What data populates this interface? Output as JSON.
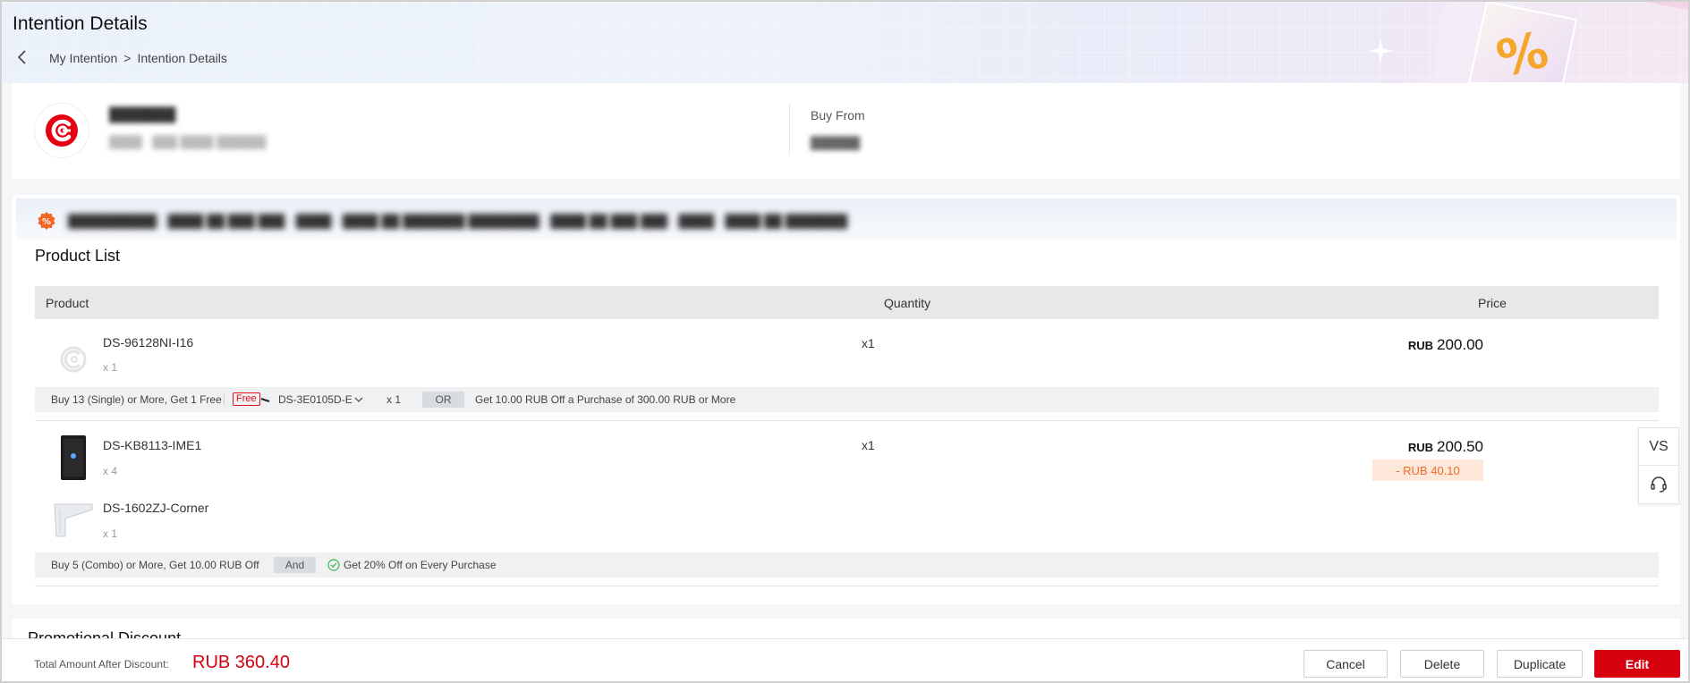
{
  "header": {
    "title": "Intention Details",
    "breadcrumb": [
      "My Intention",
      "Intention Details"
    ],
    "breadcrumb_separator": ">"
  },
  "seller": {
    "name": "███████",
    "contact": "████ · ███ ████ ██████",
    "buy_from_label": "Buy From",
    "buy_from_value": "██████"
  },
  "promo_banner_text": "██████████ · ████ ██ ███ ███ · ████ · ████ ██ ███████ ████████ · ████ ██ ███ ███ · ████ · ████ ██ ███████",
  "product_list": {
    "title": "Product List",
    "columns": {
      "product": "Product",
      "quantity": "Quantity",
      "price": "Price"
    },
    "groups": [
      {
        "items": [
          {
            "name": "DS-96128NI-I16",
            "sub_qty": "x 1"
          }
        ],
        "quantity": "x1",
        "price_currency": "RUB",
        "price_amount": "200.00",
        "promo": {
          "rule": "Buy 13 (Single) or More, Get 1 Free",
          "free_tag": "Free",
          "gift_item": "DS-3E0105D-E",
          "gift_qty": "x 1",
          "connector": "OR",
          "alt_rule": "Get 10.00 RUB Off a Purchase of 300.00 RUB or More"
        }
      },
      {
        "items": [
          {
            "name": "DS-KB8113-IME1",
            "sub_qty": "x 4"
          },
          {
            "name": "DS-1602ZJ-Corner",
            "sub_qty": "x 1"
          }
        ],
        "quantity": "x1",
        "price_currency": "RUB",
        "price_amount": "200.50",
        "discount": "- RUB 40.10",
        "promo": {
          "rule": "Buy 5 (Combo) or More, Get 10.00 RUB Off",
          "connector": "And",
          "alt_rule": "Get 20% Off on Every Purchase"
        }
      }
    ]
  },
  "side_tools": {
    "vs_label": "VS"
  },
  "next_section_title": "Promotional Discount",
  "footer": {
    "total_label": "Total Amount After Discount:",
    "total_value": "RUB 360.40",
    "buttons": {
      "cancel": "Cancel",
      "delete": "Delete",
      "duplicate": "Duplicate",
      "edit": "Edit"
    }
  },
  "colors": {
    "accent": "#d7000f",
    "discount_text": "#f06b2a",
    "discount_bg": "#fde7d8",
    "promo_icon": "#f26522"
  }
}
